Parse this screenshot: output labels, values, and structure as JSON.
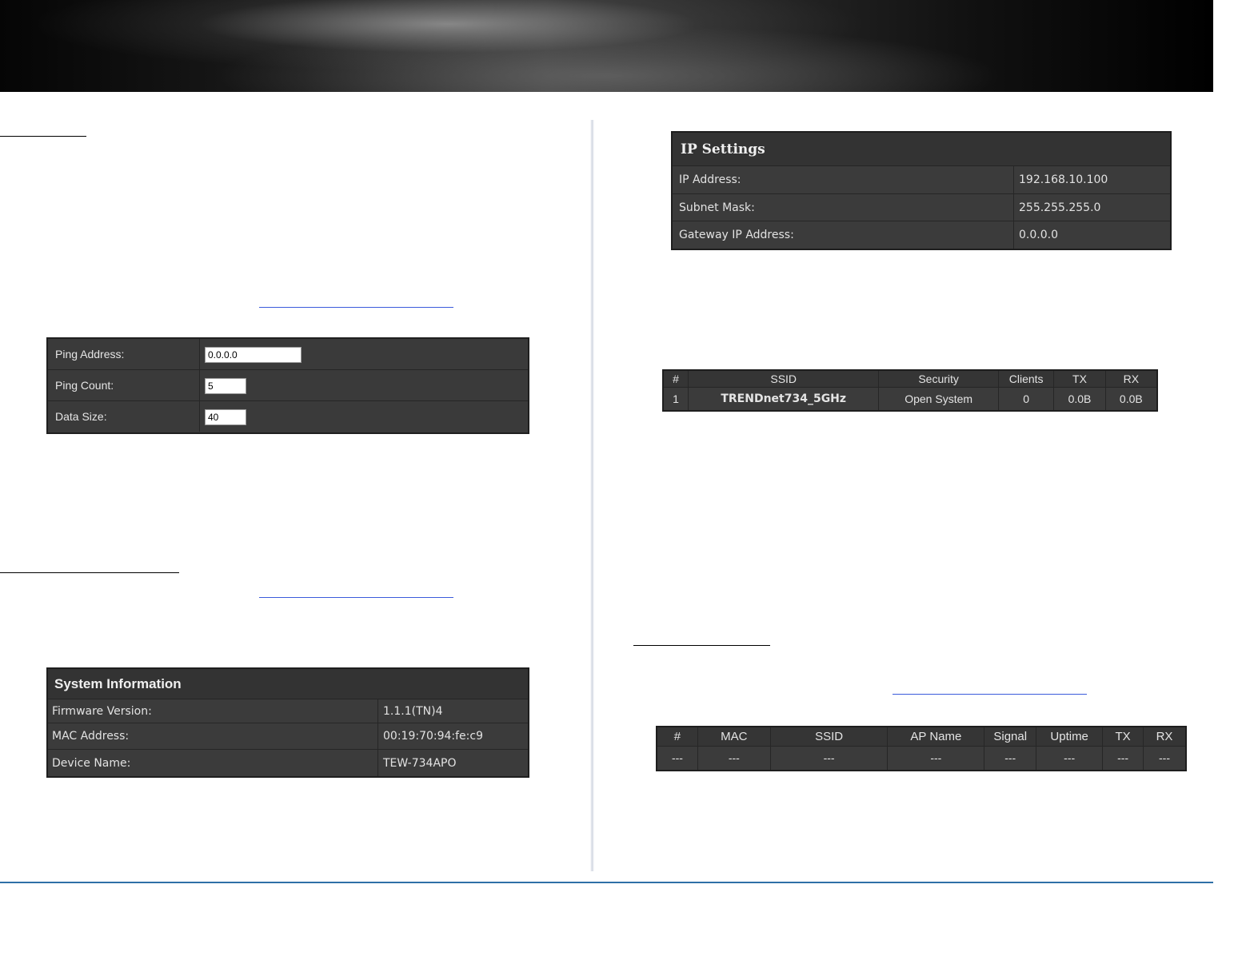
{
  "ping_form": {
    "rows": [
      {
        "label": "Ping Address:",
        "value": "0.0.0.0"
      },
      {
        "label": "Ping Count:",
        "value": "5"
      },
      {
        "label": "Data Size:",
        "value": "40"
      }
    ]
  },
  "system_info": {
    "title": "System Information",
    "rows": [
      {
        "label": "Firmware Version:",
        "value": "1.1.1(TN)4"
      },
      {
        "label": "MAC Address:",
        "value": "00:19:70:94:fe:c9"
      },
      {
        "label": "Device Name:",
        "value": "TEW-734APO"
      }
    ]
  },
  "ip_settings": {
    "title": "IP Settings",
    "rows": [
      {
        "label": "IP Address:",
        "value": "192.168.10.100"
      },
      {
        "label": "Subnet Mask:",
        "value": "255.255.255.0"
      },
      {
        "label": "Gateway IP Address:",
        "value": "0.0.0.0"
      }
    ]
  },
  "ssid_table": {
    "headers": [
      "#",
      "SSID",
      "Security",
      "Clients",
      "TX",
      "RX"
    ],
    "rows": [
      [
        "1",
        "TRENDnet734_5GHz",
        "Open System",
        "0",
        "0.0B",
        "0.0B"
      ]
    ]
  },
  "clients_table": {
    "headers": [
      "#",
      "MAC",
      "SSID",
      "AP Name",
      "Signal",
      "Uptime",
      "TX",
      "RX"
    ],
    "rows": [
      [
        "---",
        "---",
        "---",
        "---",
        "---",
        "---",
        "---",
        "---"
      ]
    ]
  },
  "colors": {
    "panel_bg": "#3b3b3b",
    "panel_border": "#1e1e1e",
    "footer_line": "#2f6fa7",
    "link_underline": "#3b5bdb"
  }
}
